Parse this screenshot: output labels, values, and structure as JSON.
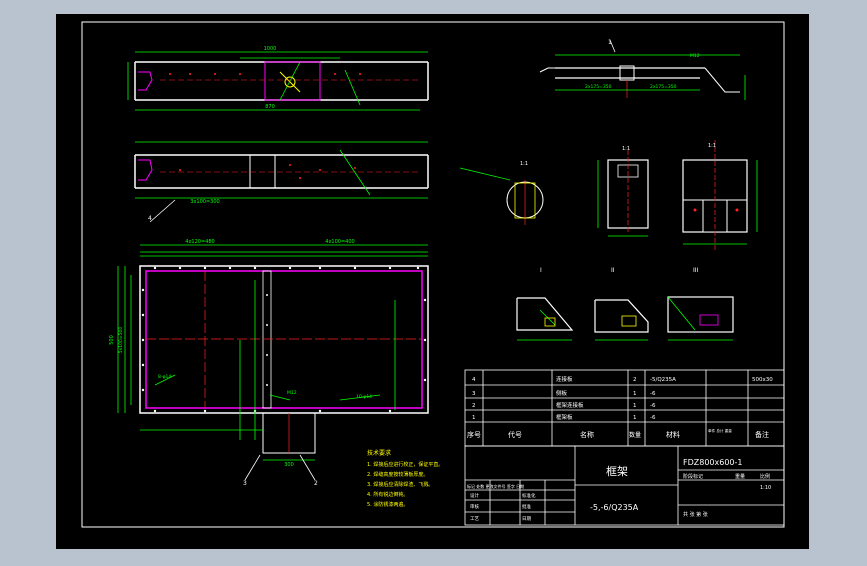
{
  "window": {
    "background": "#b9c2cf",
    "canvas_color": "#000000"
  },
  "colors": {
    "frame": "#ffffff",
    "dimension": "#00ff00",
    "outline": "#ffffff",
    "member": "#ff00ff",
    "centerline": "#ff2020",
    "hatch": "#ffff00",
    "text": "#ffffff"
  },
  "drawing": {
    "section_labels": [
      "1",
      "1:1",
      "I",
      "II",
      "III"
    ],
    "callouts": [
      "1",
      "2",
      "3",
      "4",
      "5"
    ],
    "dims": {
      "top_overall": "1000",
      "top_bottom": "870",
      "mid_base": "3x100=300",
      "plan_top": "4x120=480",
      "plan_inner": "4x100=400",
      "plan_left": "500",
      "plan_left2": "5x100=500",
      "plan_note1": "8-φ14",
      "plan_note2": "M12",
      "plan_note3": "10-φ14",
      "plan_bottom": "300",
      "right_dim1": "2x175=350",
      "right_dim2": "2x175=350",
      "right_note": "M12",
      "sec_dim": "100",
      "sec_dim2": "200"
    }
  },
  "notes": {
    "title": "技术要求",
    "lines": [
      "1. 焊接后应进行校正，保证平直。",
      "2. 焊缝高度按较薄板厚度。",
      "3. 焊接后应清除焊渣、飞溅。",
      "4. 所有锐边倒钝。",
      "5. 涂防锈漆两遍。"
    ]
  },
  "parts_table": {
    "rows": [
      {
        "no": "4",
        "name": "连接板",
        "qty": "2",
        "material": "-5/Q235A",
        "note": "500x30"
      },
      {
        "no": "3",
        "name": "侧板",
        "qty": "1",
        "material": "-6",
        "note": ""
      },
      {
        "no": "2",
        "name": "框架连接板",
        "qty": "1",
        "material": "-6",
        "note": ""
      },
      {
        "no": "1",
        "name": "框架板",
        "qty": "1",
        "material": "-6",
        "note": ""
      }
    ],
    "header": {
      "no": "序号",
      "code": "代号",
      "name": "名称",
      "qty": "数量",
      "material": "材料",
      "weight": "单件 总计 重量",
      "note": "备注"
    }
  },
  "title_block": {
    "part_name": "框架",
    "drawing_no": "FDZ800x600-1",
    "material": "-5,-6/Q235A",
    "scale_label": "比例",
    "scale": "1:10",
    "stage_label": "阶段标记",
    "weight_label": "重量",
    "sheet_label": "共 张 第 张",
    "rev_headers": "标记 处数 更改文件号 签字 日期",
    "role_design": "设计",
    "role_check": "审核",
    "role_process": "工艺",
    "role_std": "标准化",
    "role_approve": "批准",
    "date_label": "日期"
  }
}
